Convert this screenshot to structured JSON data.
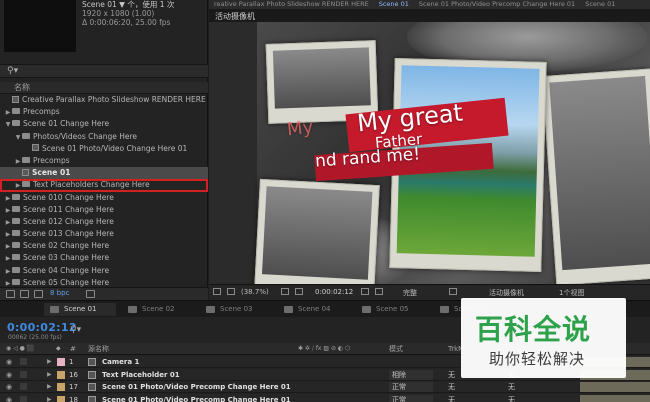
{
  "project": {
    "meta_line1": "Scene 01 ▼ 个，使用 1 次",
    "meta_line2": "1920 x 1080 (1.00)",
    "meta_line3": "Δ 0:00:06:20, 25.00 fps",
    "column_name": "名称",
    "items": [
      {
        "label": "Creative Parallax Photo Slideshow RENDER HERE",
        "kind": "comp",
        "indent": 0,
        "arrow": ""
      },
      {
        "label": "Precomps",
        "kind": "folder",
        "indent": 0,
        "arrow": "▶"
      },
      {
        "label": "Scene 01 Change Here",
        "kind": "folder",
        "indent": 0,
        "arrow": "▼"
      },
      {
        "label": "Photos/Videos Change Here",
        "kind": "folder",
        "indent": 1,
        "arrow": "▼"
      },
      {
        "label": "Scene 01 Photo/Video Change Here 01",
        "kind": "comp",
        "indent": 2,
        "arrow": ""
      },
      {
        "label": "Precomps",
        "kind": "folder",
        "indent": 1,
        "arrow": "▶"
      },
      {
        "label": "Scene 01",
        "kind": "comp",
        "indent": 1,
        "arrow": "",
        "selected": true
      },
      {
        "label": "Text Placeholders Change Here",
        "kind": "folder",
        "indent": 1,
        "arrow": "▶",
        "highlight": true
      },
      {
        "label": "Scene 010 Change Here",
        "kind": "folder",
        "indent": 0,
        "arrow": "▶"
      },
      {
        "label": "Scene 011 Change Here",
        "kind": "folder",
        "indent": 0,
        "arrow": "▶"
      },
      {
        "label": "Scene 012 Change Here",
        "kind": "folder",
        "indent": 0,
        "arrow": "▶"
      },
      {
        "label": "Scene 013 Change Here",
        "kind": "folder",
        "indent": 0,
        "arrow": "▶"
      },
      {
        "label": "Scene 02 Change Here",
        "kind": "folder",
        "indent": 0,
        "arrow": "▶"
      },
      {
        "label": "Scene 03 Change Here",
        "kind": "folder",
        "indent": 0,
        "arrow": "▶"
      },
      {
        "label": "Scene 04 Change Here",
        "kind": "folder",
        "indent": 0,
        "arrow": "▶"
      },
      {
        "label": "Scene 05 Change Here",
        "kind": "folder",
        "indent": 0,
        "arrow": "▶"
      }
    ],
    "bpc": "8 bpc"
  },
  "viewer": {
    "tabs": [
      {
        "label": "reative Parallax Photo Slideshow RENDER HERE",
        "active": false
      },
      {
        "label": "Scene 01",
        "active": true
      },
      {
        "label": "Scene 01 Photo/Video Precomp Change Here 01",
        "active": false
      },
      {
        "label": "Scene 01",
        "active": false
      }
    ],
    "camera_label": "活动摄像机",
    "text_line1": "My great",
    "text_line2": "Father",
    "text_line3": "nd rand me!",
    "ghost_text": "My",
    "zoom": "(38.7%)",
    "timecode": "0:00:02:12",
    "quality": "完整",
    "camera_menu": "活动摄像机",
    "view_menu": "1个视图"
  },
  "timeline": {
    "tabs": [
      {
        "label": "Scene 01",
        "active": true
      },
      {
        "label": "Scene 02",
        "active": false
      },
      {
        "label": "Scene 03",
        "active": false
      },
      {
        "label": "Scene 04",
        "active": false
      },
      {
        "label": "Scene 05",
        "active": false
      },
      {
        "label": "Scene 06",
        "active": false
      }
    ],
    "current_time": "0:00:02:12",
    "fps_line": "00062 (25.00 fps)",
    "head_num": "#",
    "head_source": "源名称",
    "head_mode": "模式",
    "head_trk": "TrkM",
    "layers": [
      {
        "num": "1",
        "name": "Camera 1",
        "color": "#e3b3c4",
        "mode": "",
        "track": "",
        "parent": ""
      },
      {
        "num": "16",
        "name": "Text Placeholder 01",
        "color": "#c9a46a",
        "mode": "相除",
        "track": "无",
        "parent": "无"
      },
      {
        "num": "17",
        "name": "Scene 01 Photo/Video Precomp Change Here 01",
        "color": "#c9a46a",
        "mode": "正常",
        "track": "无",
        "parent": "无"
      },
      {
        "num": "18",
        "name": "Scene 01 Photo/Video Precomp Change Here 01",
        "color": "#c9a46a",
        "mode": "正常",
        "track": "无",
        "parent": "无"
      }
    ]
  },
  "watermark": {
    "big": "百科全说",
    "small": "助你轻松解决"
  }
}
